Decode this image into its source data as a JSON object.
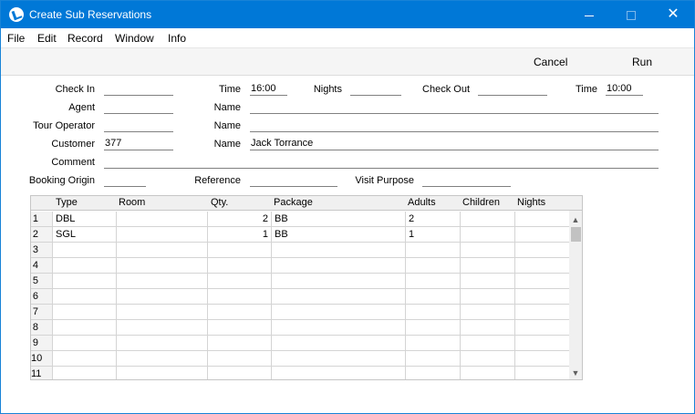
{
  "window": {
    "title": "Create Sub Reservations"
  },
  "menu": {
    "items": [
      "File",
      "Edit",
      "Record",
      "Window",
      "Info"
    ]
  },
  "toolbar": {
    "cancel_label": "Cancel",
    "run_label": "Run"
  },
  "form": {
    "check_in_label": "Check In",
    "check_in_value": "",
    "time1_label": "Time",
    "time1_value": "16:00",
    "nights_label": "Nights",
    "nights_value": "",
    "check_out_label": "Check Out",
    "check_out_value": "",
    "time2_label": "Time",
    "time2_value": "10:00",
    "agent_label": "Agent",
    "agent_value": "",
    "agent_name_label": "Name",
    "agent_name_value": "",
    "tour_operator_label": "Tour Operator",
    "tour_operator_value": "",
    "tour_operator_name_label": "Name",
    "tour_operator_name_value": "",
    "customer_label": "Customer",
    "customer_value": "377",
    "customer_name_label": "Name",
    "customer_name_value": "Jack Torrance",
    "comment_label": "Comment",
    "comment_value": "",
    "booking_origin_label": "Booking Origin",
    "booking_origin_value": "",
    "reference_label": "Reference",
    "reference_value": "",
    "visit_purpose_label": "Visit Purpose",
    "visit_purpose_value": ""
  },
  "grid": {
    "columns": [
      "Type",
      "Room",
      "Qty.",
      "Package",
      "Adults",
      "Children",
      "Nights"
    ],
    "rows": [
      {
        "num": "1",
        "type": "DBL",
        "room": "",
        "qty": "2",
        "package": "BB",
        "adults": "2",
        "children": "",
        "nights": ""
      },
      {
        "num": "2",
        "type": "SGL",
        "room": "",
        "qty": "1",
        "package": "BB",
        "adults": "1",
        "children": "",
        "nights": ""
      },
      {
        "num": "3",
        "type": "",
        "room": "",
        "qty": "",
        "package": "",
        "adults": "",
        "children": "",
        "nights": ""
      },
      {
        "num": "4",
        "type": "",
        "room": "",
        "qty": "",
        "package": "",
        "adults": "",
        "children": "",
        "nights": ""
      },
      {
        "num": "5",
        "type": "",
        "room": "",
        "qty": "",
        "package": "",
        "adults": "",
        "children": "",
        "nights": ""
      },
      {
        "num": "6",
        "type": "",
        "room": "",
        "qty": "",
        "package": "",
        "adults": "",
        "children": "",
        "nights": ""
      },
      {
        "num": "7",
        "type": "",
        "room": "",
        "qty": "",
        "package": "",
        "adults": "",
        "children": "",
        "nights": ""
      },
      {
        "num": "8",
        "type": "",
        "room": "",
        "qty": "",
        "package": "",
        "adults": "",
        "children": "",
        "nights": ""
      },
      {
        "num": "9",
        "type": "",
        "room": "",
        "qty": "",
        "package": "",
        "adults": "",
        "children": "",
        "nights": ""
      },
      {
        "num": "10",
        "type": "",
        "room": "",
        "qty": "",
        "package": "",
        "adults": "",
        "children": "",
        "nights": ""
      },
      {
        "num": "11",
        "type": "",
        "room": "",
        "qty": "",
        "package": "",
        "adults": "",
        "children": "",
        "nights": ""
      }
    ]
  },
  "icons": {
    "app": "app-logo-icon",
    "minimize": "minimize-icon",
    "maximize": "maximize-icon",
    "close": "close-icon",
    "scroll_up": "chevron-up-icon",
    "scroll_down": "chevron-down-icon"
  },
  "colors": {
    "titlebar": "#0078d7",
    "toolbar": "#f5f5f5"
  }
}
